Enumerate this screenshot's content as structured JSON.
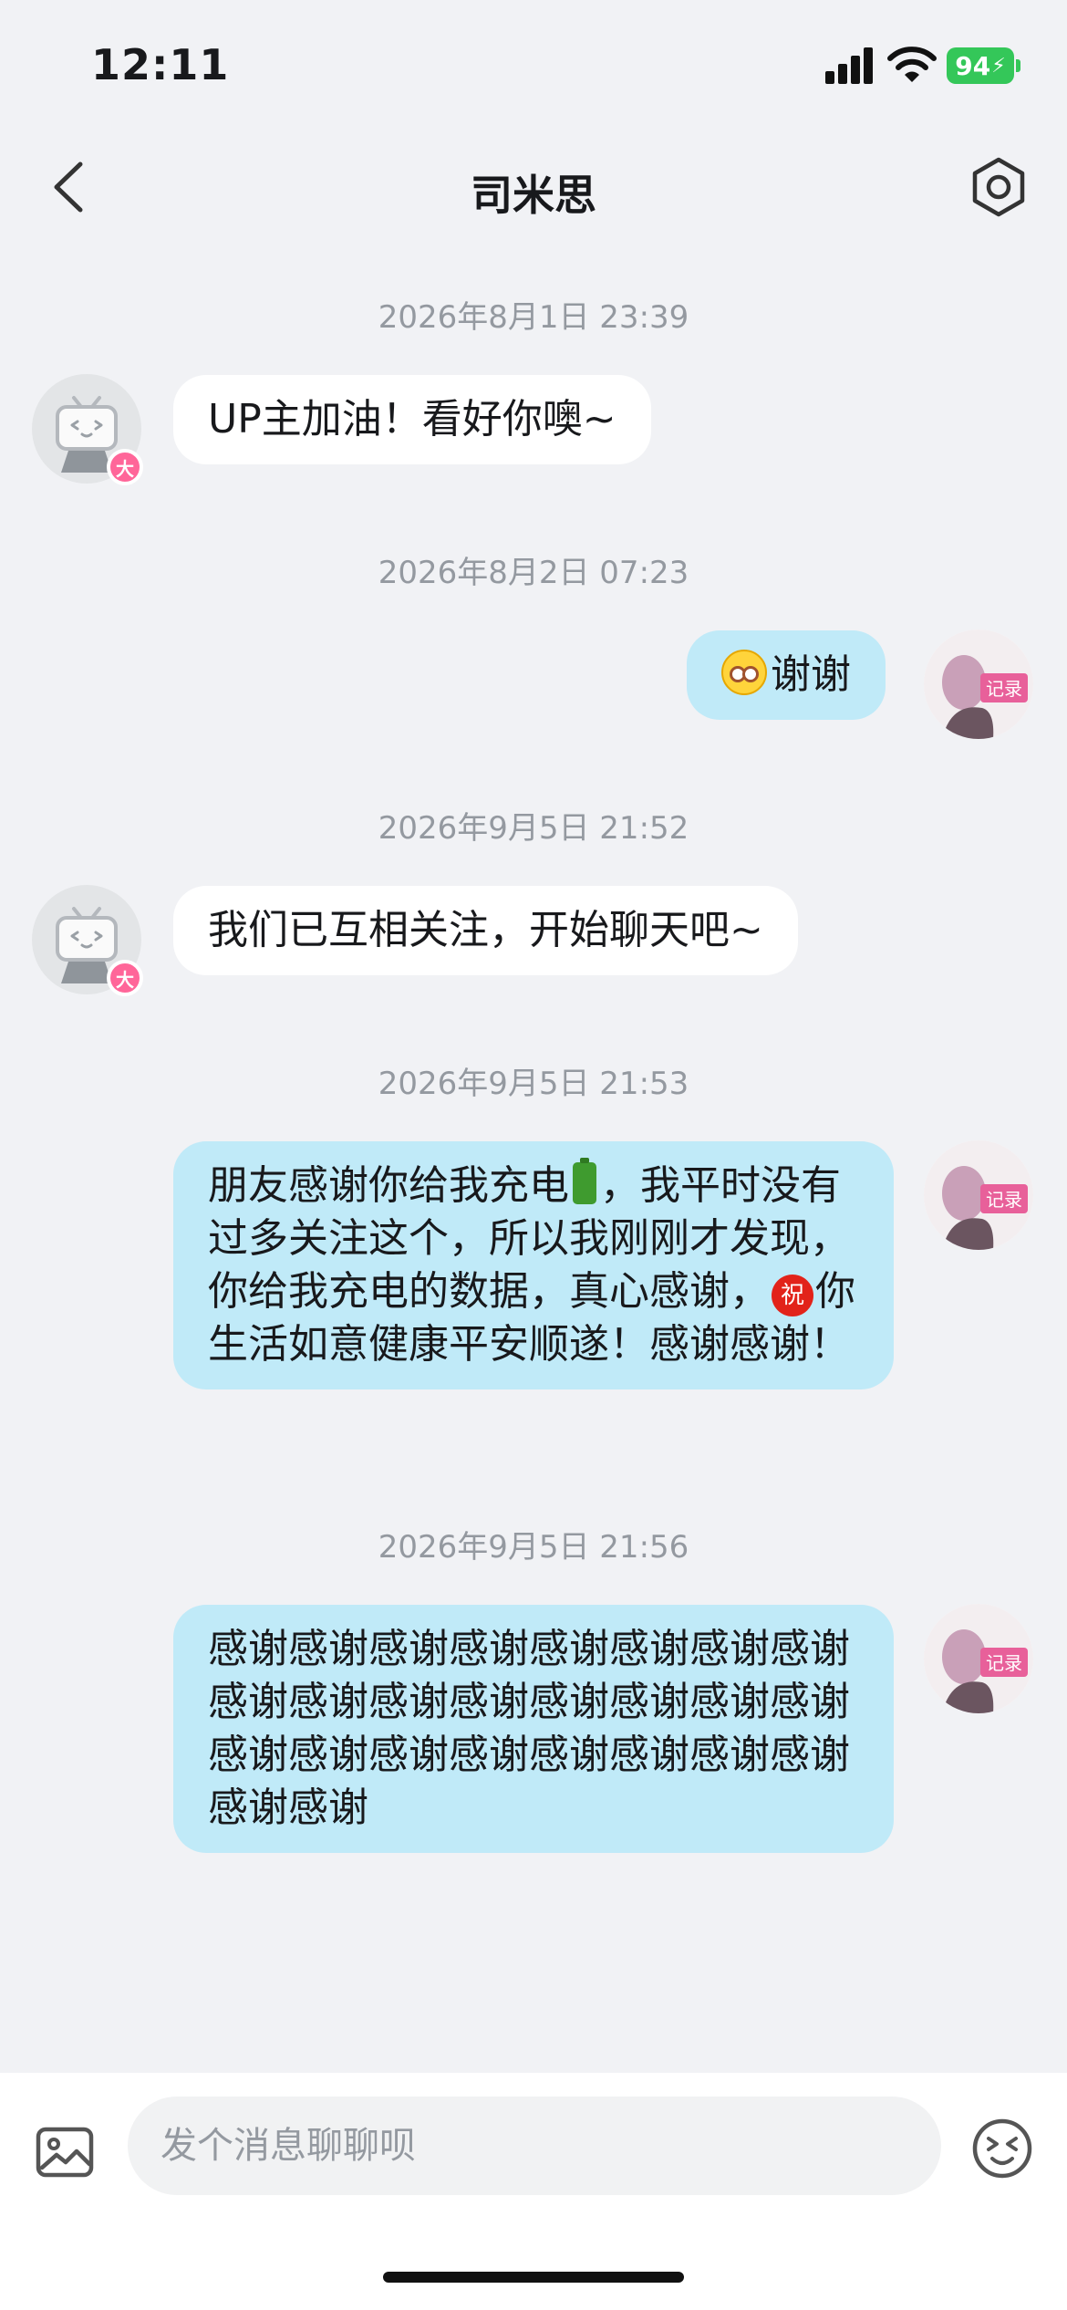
{
  "status_bar": {
    "time": "12:11",
    "battery": "94"
  },
  "header": {
    "title": "司米思"
  },
  "icons": {
    "back": "chevron-left-icon",
    "settings": "settings-hexagon-icon",
    "image": "image-icon",
    "emoji": "emoji-face-icon"
  },
  "colors": {
    "background": "#f1f2f5",
    "bubble_received": "#ffffff",
    "bubble_sent": "#c0eaf8",
    "badge": "#ff6699",
    "battery": "#34c759"
  },
  "messages": [
    {
      "timestamp": "2026年8月1日 23:39",
      "side": "left",
      "text": "UP主加油！看好你噢~",
      "avatar_badge": "大"
    },
    {
      "timestamp": "2026年8月2日 07:23",
      "side": "right",
      "text": "谢谢"
    },
    {
      "timestamp": "2026年9月5日 21:52",
      "side": "left",
      "text": "我们已互相关注，开始聊天吧~",
      "avatar_badge": "大"
    },
    {
      "timestamp": "2026年9月5日 21:53",
      "side": "right",
      "text_parts": [
        "朋友感谢你给我充电",
        "，我平时没有过多关注这个，所以我刚刚才发现，你给我充电的数据，真心感谢，",
        "你生活如意健康平安顺遂！感谢感谢！"
      ],
      "emoji_zhu": "祝"
    },
    {
      "timestamp": "2026年9月5日 21:56",
      "side": "right",
      "text": "感谢感谢感谢感谢感谢感谢感谢感谢感谢感谢感谢感谢感谢感谢感谢感谢感谢感谢感谢感谢感谢感谢感谢感谢感谢感谢"
    }
  ],
  "input": {
    "placeholder": "发个消息聊聊呗"
  }
}
